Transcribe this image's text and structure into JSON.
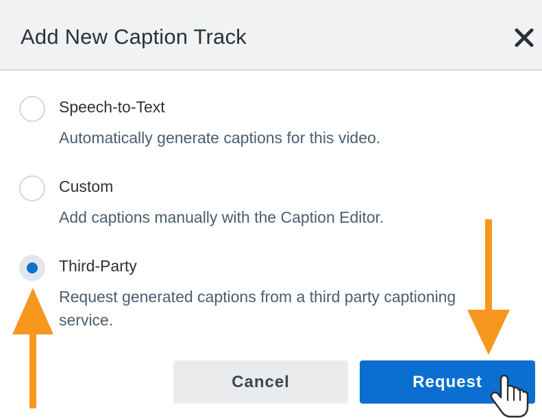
{
  "dialog": {
    "title": "Add New Caption Track",
    "close_icon": "close-icon"
  },
  "options": [
    {
      "label": "Speech-to-Text",
      "description": "Automatically generate captions for this video.",
      "selected": false
    },
    {
      "label": "Custom",
      "description": "Add captions manually with the Caption Editor.",
      "selected": false
    },
    {
      "label": "Third-Party",
      "description": "Request generated captions from a third party captioning service.",
      "selected": true
    }
  ],
  "buttons": {
    "cancel_label": "Cancel",
    "request_label": "Request"
  },
  "annotations": {
    "arrow_color": "#f7971e",
    "arrow_icon": "arrow-icon",
    "cursor_icon": "hand-pointer-icon"
  },
  "colors": {
    "accent": "#0a6fd0",
    "header_bg": "#f1f2f3",
    "text": "#2b3136",
    "description_text": "#4a5d6e"
  }
}
